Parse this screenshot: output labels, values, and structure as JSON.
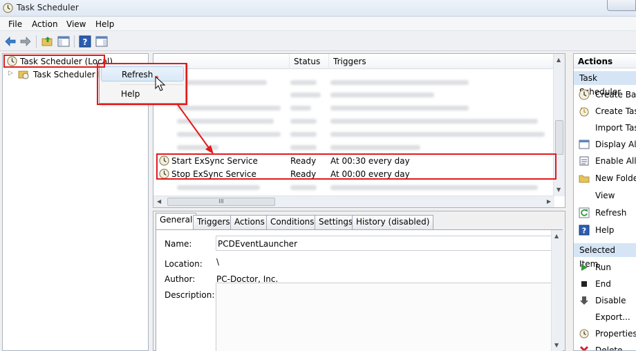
{
  "window": {
    "title": "Task Scheduler"
  },
  "menu": [
    "File",
    "Action",
    "View",
    "Help"
  ],
  "tree": {
    "root": "Task Scheduler (Local)",
    "child": "Task Scheduler Library"
  },
  "context_menu": {
    "refresh": "Refresh",
    "help": "Help"
  },
  "task_list": {
    "columns": {
      "status": "Status",
      "triggers": "Triggers"
    },
    "visible_rows": [
      {
        "name": "Start ExSync Service",
        "status": "Ready",
        "trigger": "At 00:30 every day"
      },
      {
        "name": "Stop ExSync Service",
        "status": "Ready",
        "trigger": "At 00:00 every day"
      }
    ],
    "scroll_grip": "III"
  },
  "details": {
    "tabs": [
      "General",
      "Triggers",
      "Actions",
      "Conditions",
      "Settings",
      "History (disabled)"
    ],
    "name_label": "Name:",
    "name_value": "PCDEventLauncher",
    "location_label": "Location:",
    "location_value": "\\",
    "author_label": "Author:",
    "author_value": "PC-Doctor, Inc.",
    "description_label": "Description:"
  },
  "actions_panel": {
    "header": "Actions",
    "section1": "Task Scheduler",
    "items1": [
      "Create Basi",
      "Create Task",
      "Import Task",
      "Display All",
      "Enable All T",
      "New Folder",
      "View",
      "Refresh",
      "Help"
    ],
    "section2": "Selected Item",
    "items2": [
      "Run",
      "End",
      "Disable",
      "Export...",
      "Properties",
      "Delete"
    ]
  },
  "colors": {
    "highlight": "#e01b1b",
    "selection": "#3399ff",
    "header_band": "#d6e5f5"
  }
}
